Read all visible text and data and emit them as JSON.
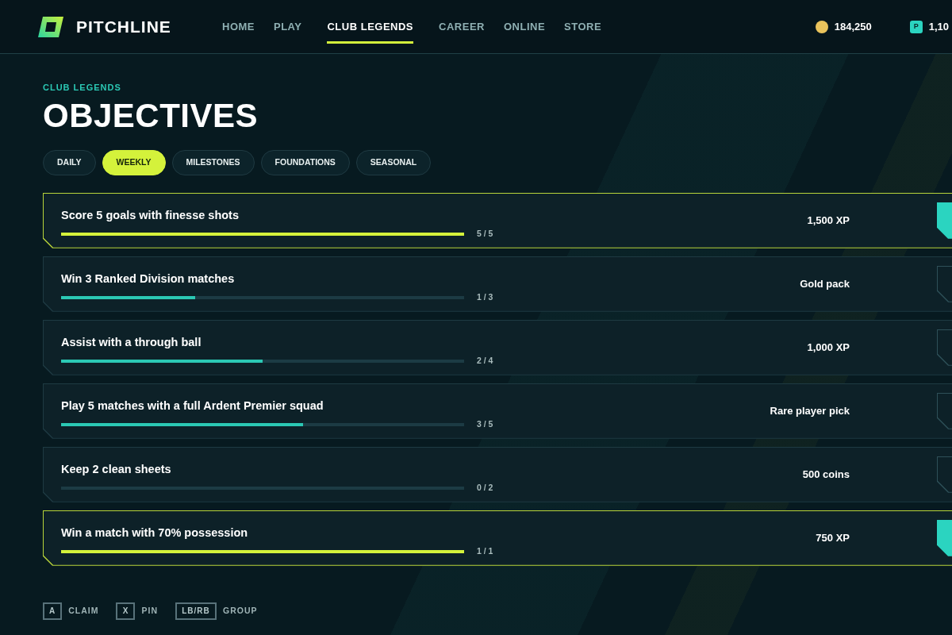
{
  "brand": {
    "name": "PITCHLINE"
  },
  "nav": [
    {
      "label": "HOME",
      "selected": false
    },
    {
      "label": "PLAY",
      "selected": false
    },
    {
      "label": "CLUB LEGENDS",
      "selected": true
    },
    {
      "label": "CAREER",
      "selected": false
    },
    {
      "label": "ONLINE",
      "selected": false
    },
    {
      "label": "STORE",
      "selected": false
    }
  ],
  "currencies": [
    {
      "kind": "coins",
      "amount": "184,250"
    },
    {
      "kind": "points",
      "icon_text": "P",
      "amount": "1,10"
    }
  ],
  "eyebrow": "CLUB LEGENDS",
  "title": "OBJECTIVES",
  "tabs": [
    {
      "label": "DAILY",
      "selected": false
    },
    {
      "label": "WEEKLY",
      "selected": true
    },
    {
      "label": "MILESTONES",
      "selected": false
    },
    {
      "label": "FOUNDATIONS",
      "selected": false
    },
    {
      "label": "SEASONAL",
      "selected": false
    }
  ],
  "objectives": [
    {
      "title": "Score 5 goals with finesse shots",
      "level": 1,
      "count": "5 / 5",
      "reward": "1,500 XP",
      "completed": true
    },
    {
      "title": "Win 3 Ranked Division matches",
      "level": 0.333,
      "count": "1 / 3",
      "reward": "Gold pack",
      "completed": false
    },
    {
      "title": "Assist with a through ball",
      "level": 0.5,
      "count": "2 / 4",
      "reward": "1,000 XP",
      "completed": false
    },
    {
      "title": "Play 5 matches with a full Ardent Premier squad",
      "level": 0.6,
      "count": "3 / 5",
      "reward": "Rare player pick",
      "completed": false
    },
    {
      "title": "Keep 2 clean sheets",
      "level": 0,
      "count": "0 / 2",
      "reward": "500 coins",
      "completed": false
    },
    {
      "title": "Win a match with 70% possession",
      "level": 1,
      "count": "1 / 1",
      "reward": "750 XP",
      "completed": true
    }
  ],
  "hints": [
    {
      "key": "A",
      "action": "CLAIM"
    },
    {
      "key": "X",
      "action": "PIN"
    },
    {
      "key": "LB/RB",
      "action": "GROUP"
    }
  ]
}
